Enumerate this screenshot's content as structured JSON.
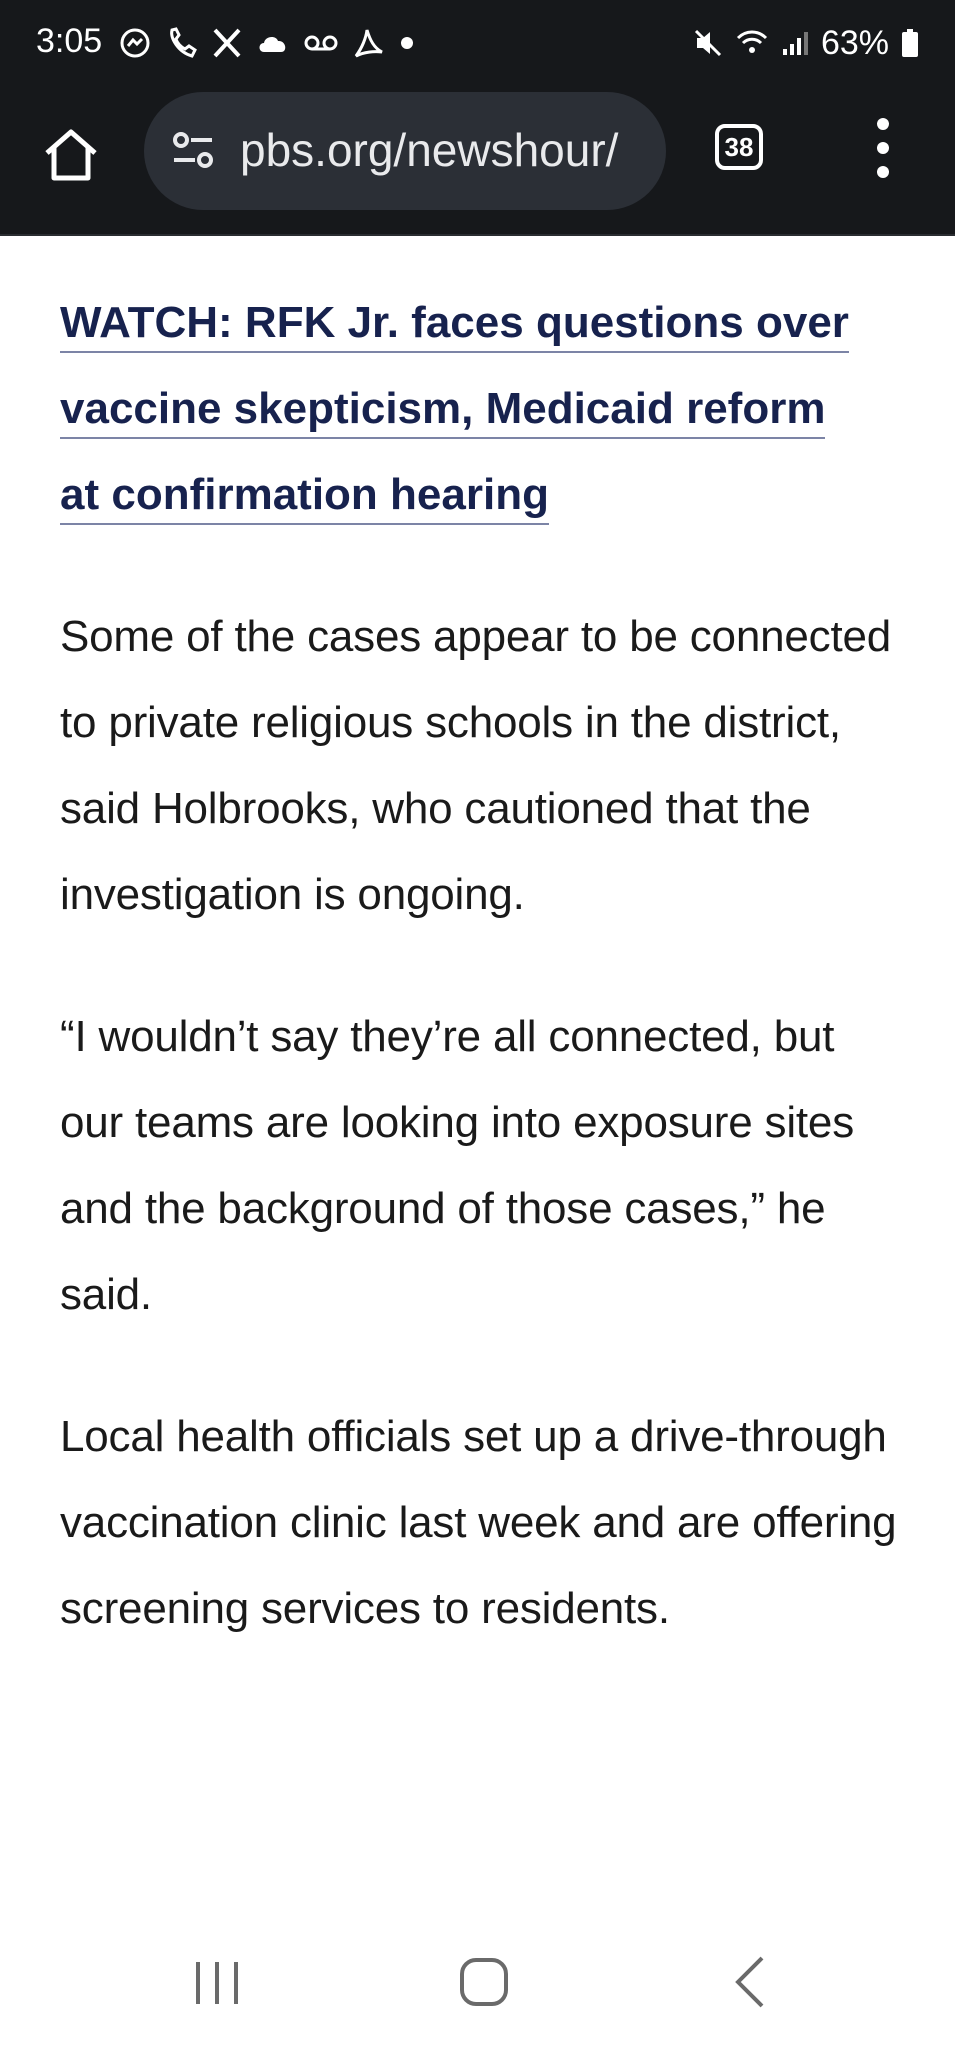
{
  "status_bar": {
    "time": "3:05",
    "battery": "63%",
    "icons_left": [
      "messenger-icon",
      "wifi-calling-icon",
      "x-icon",
      "cloud-icon",
      "voicemail-icon",
      "acrobat-icon",
      "dot-icon"
    ],
    "icons_right": [
      "mute-icon",
      "wifi-icon",
      "signal-icon",
      "battery-icon"
    ]
  },
  "toolbar": {
    "url": "pbs.org/newshour/",
    "tab_count": "38"
  },
  "article": {
    "link_lines": [
      "WATCH: RFK Jr. faces questions over",
      "vaccine skepticism, Medicaid reform",
      "at confirmation hearing"
    ],
    "paragraphs": [
      "Some of the cases appear to be connected to private religious schools in the district, said Holbrooks, who cautioned that the investigation is ongoing.",
      "“I wouldn’t say they’re all connected, but our teams are looking into exposure sites and the background of those cases,” he said.",
      "Local health officials set up a drive-through vaccination clinic last week and are offering screening services to residents."
    ]
  },
  "colors": {
    "toolbar_bg": "#16181b",
    "url_bar_bg": "#2b2f36",
    "link_color": "#17224e",
    "body_text": "#1a1a1a"
  }
}
